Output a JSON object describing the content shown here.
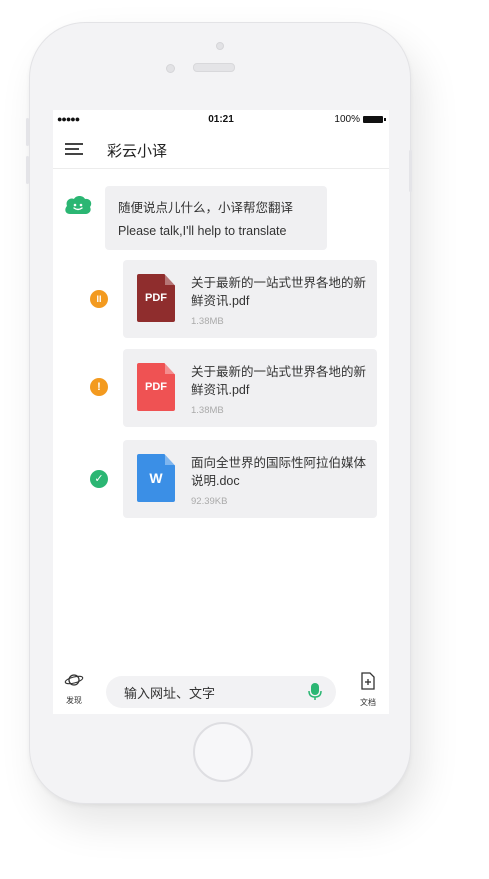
{
  "status_bar": {
    "signal": "●●●●●",
    "time": "01:21",
    "battery": "100%"
  },
  "nav": {
    "title": "彩云小译"
  },
  "bot_message": {
    "line_1": "随便说点儿什么，小译帮您翻译",
    "line_2": "Please talk,I'll help to translate"
  },
  "files": [
    {
      "name": "关于最新的一站式世界各地的新鲜资讯.pdf",
      "size": "1.38MB",
      "type_label": "PDF",
      "icon_color": "#8f2d2d",
      "status": "paused",
      "status_glyph": "II",
      "status_color": "#f39a1f"
    },
    {
      "name": "关于最新的一站式世界各地的新鲜资讯.pdf",
      "size": "1.38MB",
      "type_label": "PDF",
      "icon_color": "#ef5253",
      "status": "error",
      "status_glyph": "!",
      "status_color": "#f39a1f"
    },
    {
      "name": "面向全世界的国际性阿拉伯媒体说明.doc",
      "size": "92.39KB",
      "type_label": "W",
      "icon_color": "#3b8fe6",
      "status": "done",
      "status_glyph": "✓",
      "status_color": "#2bb673"
    }
  ],
  "bottom_bar": {
    "discover_label": "发现",
    "input_placeholder": "输入网址、文字",
    "docs_label": "文档"
  },
  "colors": {
    "accent_green": "#2bb673",
    "bubble_bg": "#f0f0f2"
  }
}
